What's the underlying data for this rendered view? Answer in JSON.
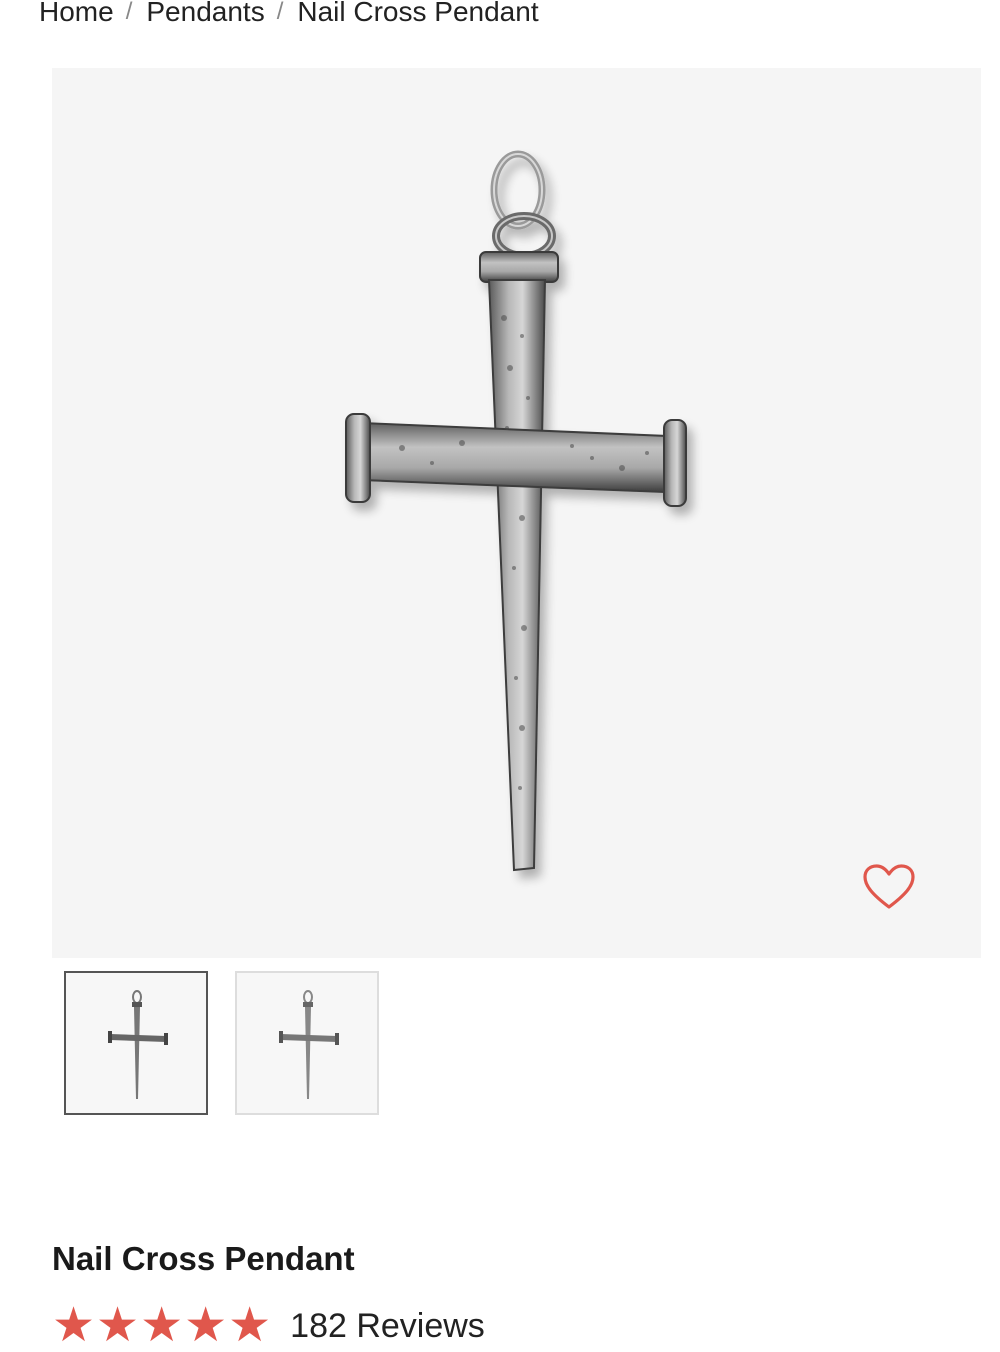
{
  "breadcrumb": {
    "items": [
      "Home",
      "Pendants",
      "Nail Cross Pendant"
    ],
    "separator": "/"
  },
  "product": {
    "title": "Nail Cross Pendant",
    "rating": 5,
    "rating_max": 5,
    "reviews_label": "182 Reviews",
    "star_glyph": "★"
  },
  "gallery": {
    "thumbnail_count": 2,
    "selected_index": 0
  },
  "icons": {
    "wishlist": "heart-outline-icon",
    "rating": "star-icon"
  },
  "colors": {
    "accent": "#e0574c",
    "image_background": "#f5f5f5",
    "text": "#1a1a1a"
  }
}
